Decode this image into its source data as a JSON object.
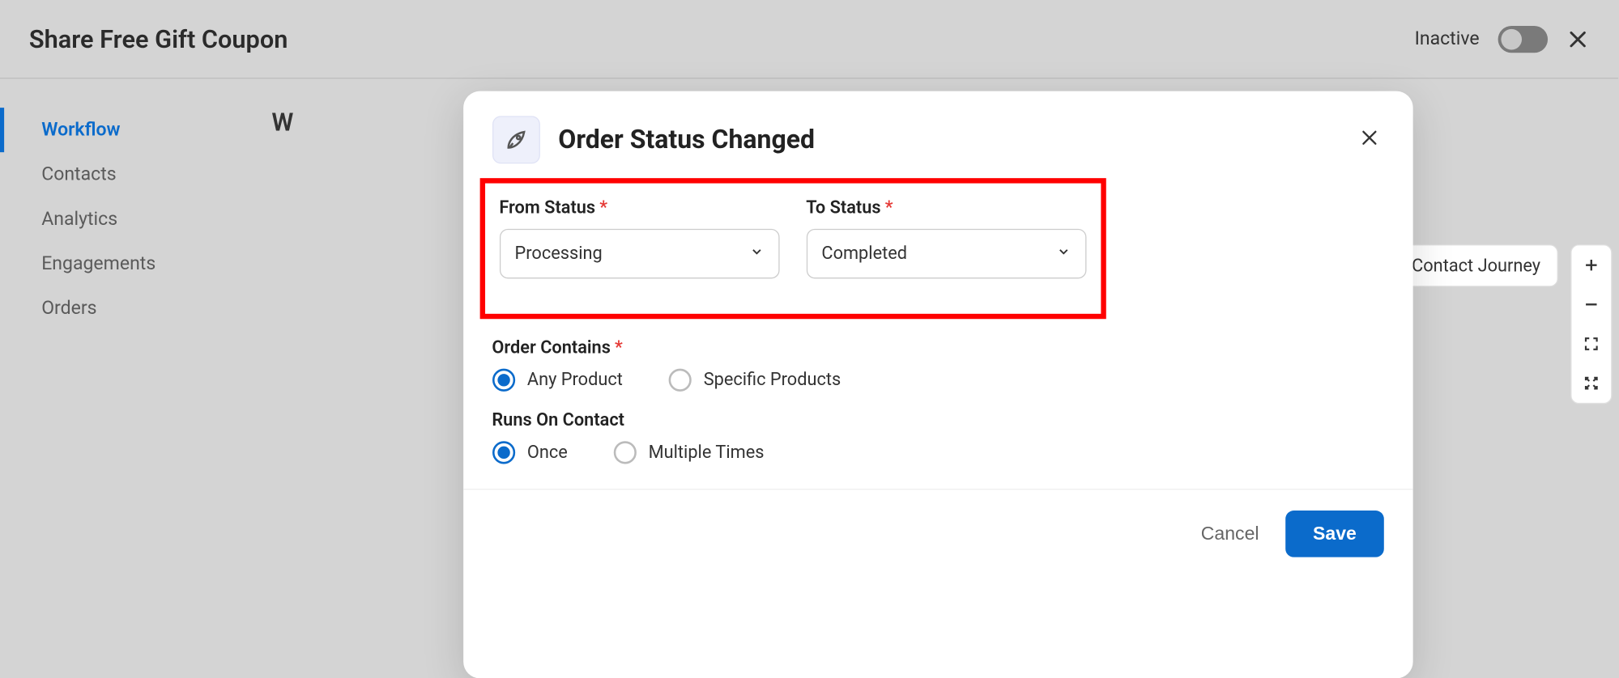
{
  "header": {
    "title": "Share Free Gift Coupon",
    "status": "Inactive"
  },
  "sidebar": {
    "items": [
      {
        "label": "Workflow",
        "active": true
      },
      {
        "label": "Contacts",
        "active": false
      },
      {
        "label": "Analytics",
        "active": false
      },
      {
        "label": "Engagements",
        "active": false
      },
      {
        "label": "Orders",
        "active": false
      }
    ]
  },
  "canvas": {
    "partial_heading": "W",
    "journey_button": "View Contact Journey"
  },
  "modal": {
    "title": "Order Status Changed",
    "from_status": {
      "label": "From Status",
      "value": "Processing"
    },
    "to_status": {
      "label": "To Status",
      "value": "Completed"
    },
    "order_contains": {
      "label": "Order Contains",
      "options": [
        {
          "label": "Any Product",
          "checked": true
        },
        {
          "label": "Specific Products",
          "checked": false
        }
      ]
    },
    "runs_on_contact": {
      "label": "Runs On Contact",
      "options": [
        {
          "label": "Once",
          "checked": true
        },
        {
          "label": "Multiple Times",
          "checked": false
        }
      ]
    },
    "cancel": "Cancel",
    "save": "Save"
  },
  "highlight_color": "#ff0000"
}
